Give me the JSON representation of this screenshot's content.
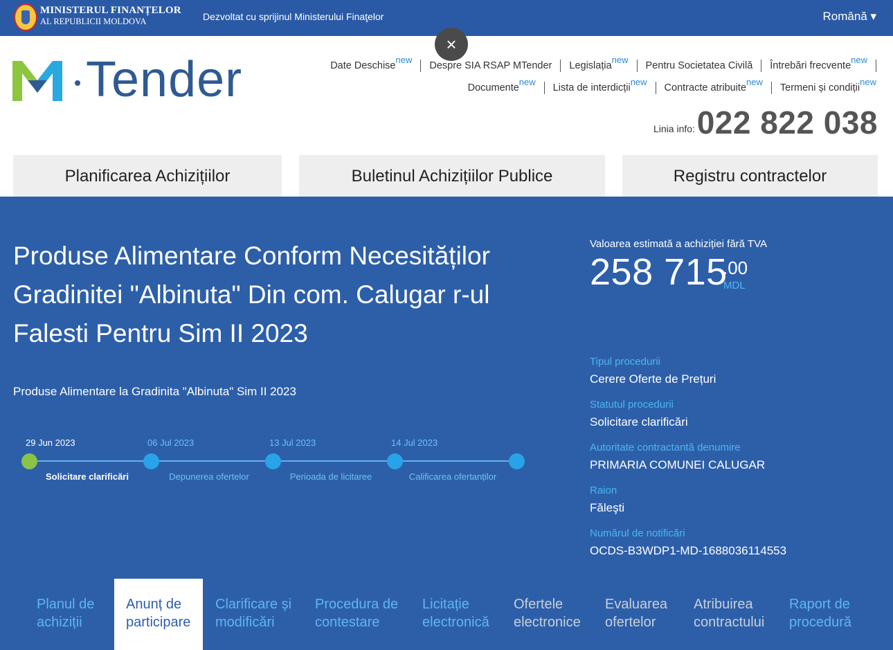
{
  "topbar": {
    "ministry_line1": "MINISTERUL FINANȚELOR",
    "ministry_line2": "AL REPUBLICII MOLDOVA",
    "support": "Dezvoltat cu sprijinul Ministerului Finaţelor",
    "language": "Română ▾"
  },
  "close_icon": "×",
  "logo": {
    "text": "Tender"
  },
  "nav": {
    "row1": [
      {
        "label": "Date Deschise",
        "badge": "new"
      },
      {
        "label": "Despre SIA RSAP MTender",
        "badge": ""
      },
      {
        "label": "Legislația",
        "badge": "new"
      },
      {
        "label": "Pentru Societatea Civilă",
        "badge": ""
      },
      {
        "label": "Întrebări frecvente",
        "badge": "new"
      }
    ],
    "row2": [
      {
        "label": "Documente",
        "badge": "new"
      },
      {
        "label": "Lista de interdicții",
        "badge": "new"
      },
      {
        "label": "Contracte atribuite",
        "badge": "new"
      },
      {
        "label": "Termeni și condiții",
        "badge": "new"
      }
    ]
  },
  "info": {
    "label": "Linia info:",
    "phone": "022 822 038"
  },
  "main_tabs": [
    "Planificarea Achizițiilor",
    "Buletinul Achizițiilor Publice",
    "Registru contractelor"
  ],
  "tender": {
    "title": "Produse Alimentare Conform Necesităților Gradinitei \"Albinuta\" Din com. Calugar r-ul Falesti Pentru Sim II 2023",
    "subtitle": "Produse Alimentare la Gradinita \"Albinuta\" Sim II 2023",
    "value_label": "Valoarea estimată a achiziției fără TVA",
    "value_amount": "258 715",
    "value_decimals": ".00",
    "value_currency": "MDL"
  },
  "timeline": {
    "dates": [
      "29 Jun 2023",
      "06 Jul 2023",
      "13 Jul 2023",
      "14 Jul 2023"
    ],
    "stages": [
      "Solicitare clarificări",
      "Depunerea ofertelor",
      "Perioada de licitaree",
      "Calificarea ofertanților"
    ],
    "active_index": 0
  },
  "facts": [
    {
      "label": "Tipul procedurii",
      "value": "Cerere Oferte de Prețuri"
    },
    {
      "label": "Statutul procedurii",
      "value": "Solicitare clarificări"
    },
    {
      "label": "Autoritate contractantă denumire",
      "value": "PRIMARIA COMUNEI CALUGAR"
    },
    {
      "label": "Raion",
      "value": "Făleşti"
    },
    {
      "label": "Numărul de notificări",
      "value": "OCDS-B3WDP1-MD-1688036114553"
    }
  ],
  "bottom_tabs": [
    {
      "label1": "Planul de",
      "label2": "achiziții"
    },
    {
      "label1": "Anunț de",
      "label2": "participare"
    },
    {
      "label1": "Clarificare și",
      "label2": "modificări"
    },
    {
      "label1": "Procedura de",
      "label2": "contestare"
    },
    {
      "label1": "Licitație",
      "label2": "electronică"
    },
    {
      "label1": "Ofertele",
      "label2": "electronice"
    },
    {
      "label1": "Evaluarea",
      "label2": "ofertelor"
    },
    {
      "label1": "Atribuirea",
      "label2": "contractului"
    },
    {
      "label1": "Raport de",
      "label2": "procedură"
    }
  ]
}
